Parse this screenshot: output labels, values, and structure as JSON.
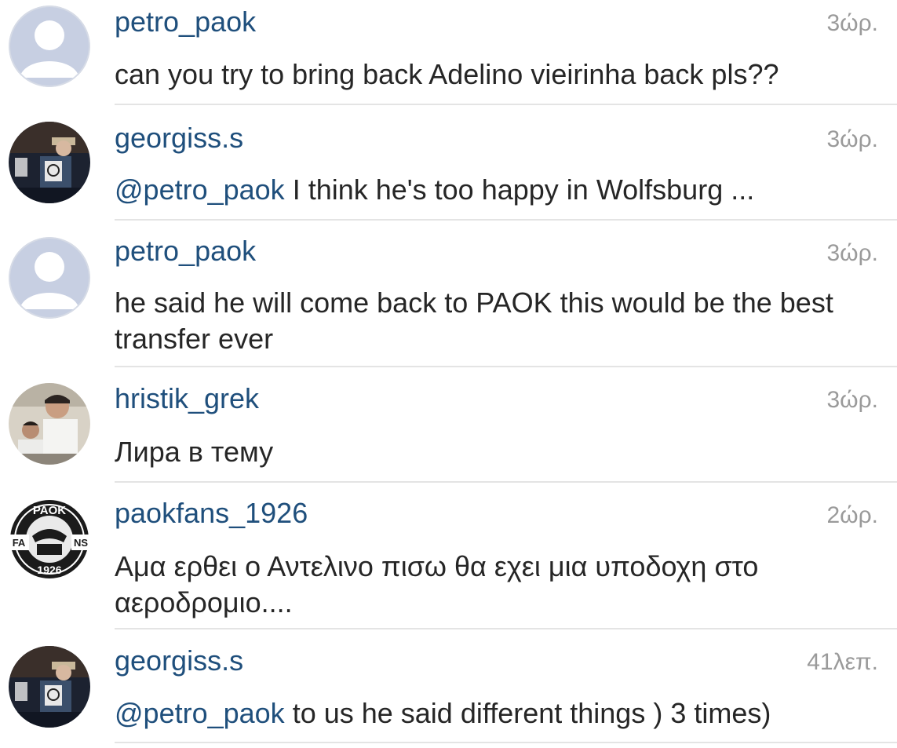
{
  "comments": [
    {
      "username": "petro_paok",
      "time": "3ώρ.",
      "mention": "",
      "text": "can you try to bring back Adelino vieirinha back pls??",
      "avatar": "default-user-icon"
    },
    {
      "username": "georgiss.s",
      "time": "3ώρ.",
      "mention": "@petro_paok",
      "text": " I think he's too happy in Wolfsburg ...",
      "avatar": "user-photo"
    },
    {
      "username": "petro_paok",
      "time": "3ώρ.",
      "mention": "",
      "text": "he said he will come back to PAOK this would be the best transfer ever",
      "avatar": "default-user-icon"
    },
    {
      "username": "hristik_grek",
      "time": "3ώρ.",
      "mention": "",
      "text": "Лира в тему",
      "avatar": "user-photo"
    },
    {
      "username": "paokfans_1926",
      "time": "2ώρ.",
      "mention": "",
      "text": "Αμα ερθει ο Αντελινο πισω θα εχει μια υποδοχη στο αεροδρομιο....",
      "avatar": "paok-fans-logo",
      "logo_text": "PAOK FANS 1926"
    },
    {
      "username": "georgiss.s",
      "time": "41λεπ.",
      "mention": "@petro_paok",
      "text": " to us he said different things ) 3 times)",
      "avatar": "user-photo"
    }
  ],
  "colors": {
    "username": "#1f4f7c",
    "text": "#262626",
    "time": "#9a9a9a",
    "divider": "#e4e4e4",
    "default_avatar_bg": "#c7cfe2"
  }
}
